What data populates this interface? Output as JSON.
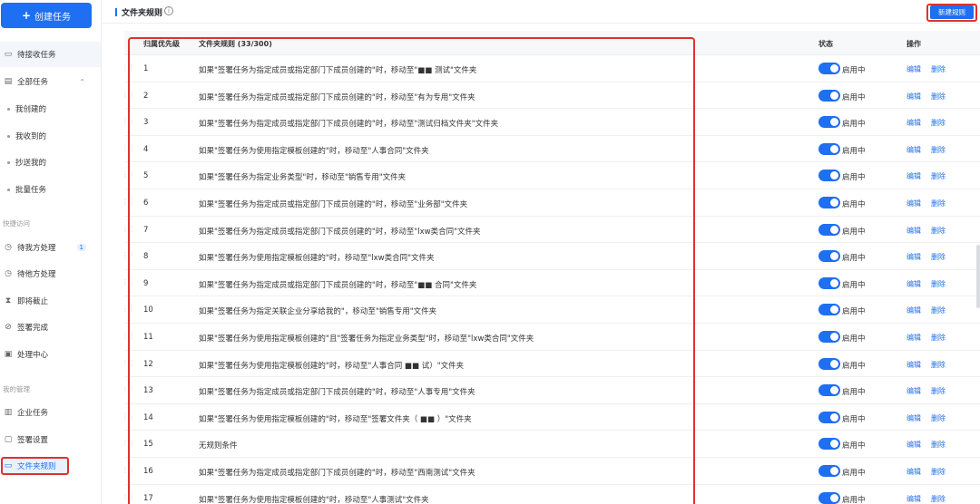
{
  "sidebar": {
    "create_label": "创建任务",
    "items": [
      {
        "label": "待接收任务",
        "icon": "inbox-icon"
      },
      {
        "label": "全部任务",
        "icon": "document-icon"
      },
      {
        "label": "我创建的"
      },
      {
        "label": "我收到的"
      },
      {
        "label": "抄送我的"
      },
      {
        "label": "批量任务"
      }
    ],
    "quick_section": "快捷访问",
    "quick_items": [
      {
        "label": "待我方处理",
        "icon": "clock-icon",
        "badge": "1"
      },
      {
        "label": "待他方处理",
        "icon": "clock-icon"
      },
      {
        "label": "即将截止",
        "icon": "hourglass-icon"
      },
      {
        "label": "签署完成",
        "icon": "check-circle-icon"
      },
      {
        "label": "处理中心",
        "icon": "box-icon"
      }
    ],
    "manage_section": "我的管理",
    "manage_items": [
      {
        "label": "企业任务",
        "icon": "building-icon"
      },
      {
        "label": "签署设置",
        "icon": "settings-icon"
      },
      {
        "label": "文件夹规则",
        "icon": "folder-icon"
      }
    ]
  },
  "header": {
    "title": "文件夹规则",
    "new_rule_label": "新建规则"
  },
  "table": {
    "col_priority": "归属优先级",
    "col_rule": "文件夹规则 (33/300)",
    "col_status": "状态",
    "col_ops": "操作",
    "status_label": "启用中",
    "edit_label": "编辑",
    "delete_label": "删除",
    "rows": [
      {
        "p": "1",
        "rule": "如果\"签署任务为指定成员或指定部门下成员创建的\"时，移动至\"■■ 测试\"文件夹"
      },
      {
        "p": "2",
        "rule": "如果\"签署任务为指定成员或指定部门下成员创建的\"时，移动至\"有为专用\"文件夹"
      },
      {
        "p": "3",
        "rule": "如果\"签署任务为指定成员或指定部门下成员创建的\"时，移动至\"测试归档文件夹\"文件夹"
      },
      {
        "p": "4",
        "rule": "如果\"签署任务为使用指定模板创建的\"时，移动至\"人事合同\"文件夹"
      },
      {
        "p": "5",
        "rule": "如果\"签署任务为指定业务类型\"时，移动至\"销售专用\"文件夹"
      },
      {
        "p": "6",
        "rule": "如果\"签署任务为指定成员或指定部门下成员创建的\"时，移动至\"业务部\"文件夹"
      },
      {
        "p": "7",
        "rule": "如果\"签署任务为指定成员或指定部门下成员创建的\"时，移动至\"lxw类合同\"文件夹"
      },
      {
        "p": "8",
        "rule": "如果\"签署任务为使用指定模板创建的\"时，移动至\"lxw类合同\"文件夹"
      },
      {
        "p": "9",
        "rule": "如果\"签署任务为指定成员或指定部门下成员创建的\"时，移动至\"■■ 合同\"文件夹"
      },
      {
        "p": "10",
        "rule": "如果\"签署任务为指定关联企业分享给我的\"，移动至\"销售专用\"文件夹"
      },
      {
        "p": "11",
        "rule": "如果\"签署任务为使用指定模板创建的\"且\"签署任务为指定业务类型\"时，移动至\"lxw类合同\"文件夹"
      },
      {
        "p": "12",
        "rule": "如果\"签署任务为使用指定模板创建的\"时，移动至\"人事合同 ■■ 试）\"文件夹"
      },
      {
        "p": "13",
        "rule": "如果\"签署任务为指定成员或指定部门下成员创建的\"时，移动至\"人事专用\"文件夹"
      },
      {
        "p": "14",
        "rule": "如果\"签署任务为使用指定模板创建的\"时，移动至\"签署文件夹（ ■■ ）\"文件夹"
      },
      {
        "p": "15",
        "rule": "无规则条件"
      },
      {
        "p": "16",
        "rule": "如果\"签署任务为指定成员或指定部门下成员创建的\"时，移动至\"西南测试\"文件夹"
      },
      {
        "p": "17",
        "rule": "如果\"签署任务为使用指定模板创建的\"时，移动至\"人事测试\"文件夹"
      }
    ]
  },
  "colors": {
    "accent": "#1e6ff1",
    "highlight_border": "#e0322b"
  }
}
